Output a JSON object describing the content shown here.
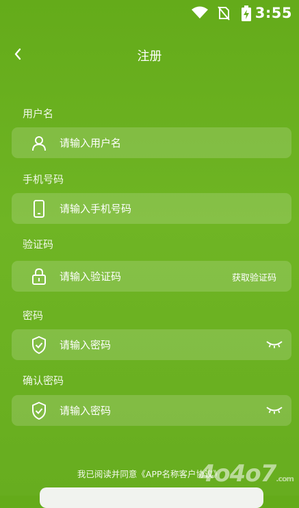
{
  "status_bar": {
    "time": "3:55",
    "icons": [
      "wifi-icon",
      "no-sim-icon",
      "battery-charging-icon"
    ]
  },
  "header": {
    "title": "注册",
    "back_icon": "chevron-left-icon"
  },
  "form": {
    "username": {
      "label": "用户名",
      "placeholder": "请输入用户名",
      "icon": "user-icon"
    },
    "phone": {
      "label": "手机号码",
      "placeholder": "请输入手机号码",
      "icon": "phone-icon"
    },
    "code": {
      "label": "验证码",
      "placeholder": "请输入验证码",
      "icon": "lock-icon",
      "action": "获取验证码"
    },
    "password": {
      "label": "密码",
      "placeholder": "请输入密码",
      "icon": "shield-check-icon",
      "toggle_icon": "eye-closed-icon"
    },
    "confirm": {
      "label": "确认密码",
      "placeholder": "请输入密码",
      "icon": "shield-check-icon",
      "toggle_icon": "eye-closed-icon"
    }
  },
  "agreement": {
    "text": "我已阅读并同意《APP名称客户协议》"
  },
  "watermark": {
    "text": "4o4o7",
    "suffix": ".com"
  },
  "colors": {
    "background": "#6ab21f",
    "field_bg": "rgba(255,255,255,0.16)",
    "text": "#ffffff"
  }
}
